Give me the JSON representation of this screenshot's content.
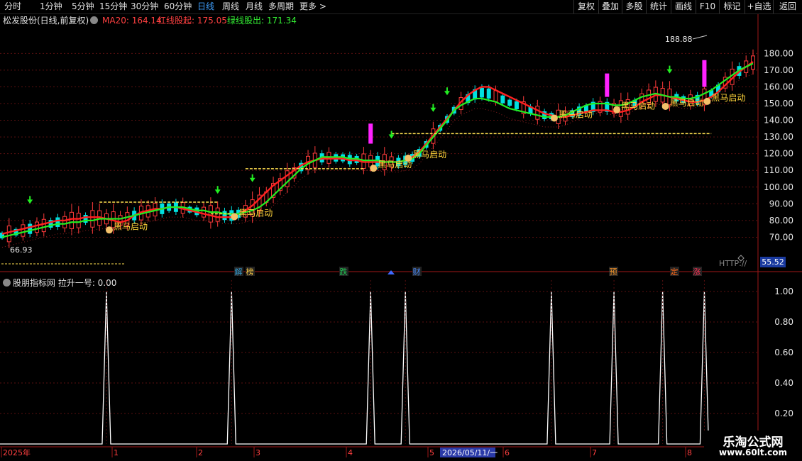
{
  "toolbar": {
    "timeframes": [
      "分时",
      "1分钟",
      "5分钟",
      "15分钟",
      "30分钟",
      "60分钟",
      "日线",
      "周线",
      "月线",
      "多周期",
      "更多 >"
    ],
    "active": "日线",
    "right_buttons": [
      "复权",
      "叠加",
      "多股",
      "统计",
      "画线",
      "F10",
      "标记",
      "+自选",
      "返回"
    ]
  },
  "info": {
    "stock": "松发股份(日线,前复权)",
    "ma20": "MA20: 164.14",
    "red_line": "红线股起: 175.05",
    "green_line": "绿线股出: 171.34"
  },
  "price_axis": {
    "ticks": [
      "180.00",
      "170.00",
      "160.00",
      "150.00",
      "140.00",
      "130.00",
      "120.00",
      "110.00",
      "100.00",
      "90.00",
      "80.00",
      "70.00"
    ],
    "current": "55.52",
    "high_label": "188.88",
    "low_label": "66.93"
  },
  "signal_label": "黑马启动",
  "event_tags": [
    "解",
    "榜",
    "跌",
    "财",
    "预",
    "定",
    "涨"
  ],
  "http_label": "HTTP://",
  "sub_panel": {
    "title": "股朋指标网 拉升一号: 0.00",
    "ticks": [
      "1.00",
      "0.80",
      "0.60",
      "0.40",
      "0.20"
    ]
  },
  "date_axis": {
    "labels": [
      "2025年",
      "1",
      "2",
      "3",
      "4",
      "5",
      "2026/05/11/一",
      "6",
      "7",
      "8"
    ]
  },
  "watermark": {
    "line1": "乐淘公式网",
    "line2": "www.60lt.com"
  },
  "colors": {
    "up": "#ff3b3b",
    "down": "#00e0e0",
    "red_line": "#ff2020",
    "green_line": "#22ee22",
    "signal": "#ffd43a"
  },
  "chart_data": {
    "type": "candlestick",
    "ylim": [
      55,
      195
    ],
    "red_line": [
      72,
      73,
      74,
      75,
      76,
      77,
      78,
      79,
      80,
      80,
      81,
      81,
      82,
      82,
      82,
      81,
      80,
      79,
      80,
      83,
      85,
      86,
      87,
      87,
      88,
      88,
      87,
      86,
      85,
      84,
      83,
      82,
      82,
      82,
      84,
      86,
      89,
      93,
      97,
      101,
      104,
      107,
      110,
      113,
      115,
      116,
      117,
      117,
      117,
      117,
      116,
      116,
      115,
      115,
      115,
      115,
      115,
      115,
      116,
      118,
      121,
      126,
      131,
      136,
      141,
      146,
      151,
      155,
      158,
      160,
      160,
      158,
      156,
      154,
      152,
      150,
      148,
      146,
      144,
      143,
      142,
      142,
      143,
      144,
      145,
      146,
      146,
      146,
      145,
      145,
      146,
      148,
      151,
      153,
      155,
      155,
      154,
      153,
      152,
      151,
      151,
      152,
      154,
      157,
      161,
      165,
      169,
      172,
      175
    ],
    "green_line": [
      70,
      71,
      72,
      73,
      74,
      75,
      76,
      77,
      78,
      78,
      79,
      79,
      80,
      80,
      81,
      81,
      81,
      81,
      82,
      83,
      84,
      85,
      86,
      87,
      88,
      88,
      88,
      87,
      86,
      86,
      85,
      85,
      84,
      84,
      84,
      85,
      86,
      88,
      91,
      95,
      99,
      103,
      107,
      111,
      114,
      116,
      118,
      118,
      118,
      118,
      117,
      117,
      116,
      116,
      116,
      115,
      115,
      115,
      116,
      117,
      120,
      125,
      130,
      135,
      140,
      146,
      149,
      151,
      153,
      153,
      152,
      151,
      149,
      147,
      146,
      145,
      144,
      143,
      142,
      142,
      142,
      143,
      145,
      147,
      149,
      150,
      150,
      150,
      149,
      149,
      150,
      152,
      154,
      155,
      156,
      155,
      154,
      154,
      153,
      153,
      154,
      156,
      158,
      161,
      164,
      167,
      170,
      172,
      174
    ],
    "signals": [
      {
        "x": 15,
        "y": 76
      },
      {
        "x": 33,
        "y": 84
      },
      {
        "x": 53,
        "y": 113
      },
      {
        "x": 58,
        "y": 119
      },
      {
        "x": 79,
        "y": 143
      },
      {
        "x": 88,
        "y": 148
      },
      {
        "x": 95,
        "y": 150
      },
      {
        "x": 101,
        "y": 153
      }
    ],
    "sub_series_peaks": [
      15,
      33,
      53,
      58,
      79,
      88,
      95,
      101
    ]
  }
}
